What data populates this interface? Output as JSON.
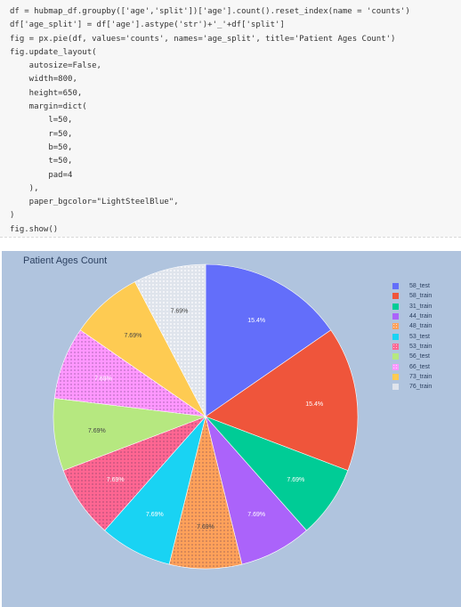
{
  "code": {
    "lines": [
      "df = hubmap_df.groupby(['age','split'])['age'].count().reset_index(name = 'counts')",
      "df['age_split'] = df['age'].astype('str')+'_'+df['split']",
      "fig = px.pie(df, values='counts', names='age_split', title='Patient Ages Count')",
      "fig.update_layout(",
      "    autosize=False,",
      "    width=800,",
      "    height=650,",
      "    margin=dict(",
      "        l=50,",
      "        r=50,",
      "        b=50,",
      "        t=50,",
      "        pad=4",
      "    ),",
      "    paper_bgcolor=\"LightSteelBlue\",",
      ")",
      "fig.show()"
    ]
  },
  "chart_data": {
    "type": "pie",
    "title": "Patient Ages Count",
    "labels": [
      "58_test",
      "58_train",
      "31_train",
      "44_train",
      "48_train",
      "53_test",
      "53_train",
      "56_test",
      "66_test",
      "73_train",
      "76_train"
    ],
    "values": [
      2,
      2,
      1,
      1,
      1,
      1,
      1,
      1,
      1,
      1,
      1
    ],
    "percent_labels": [
      "15.4%",
      "15.4%",
      "7.69%",
      "7.69%",
      "7.69%",
      "7.69%",
      "7.69%",
      "7.69%",
      "7.69%",
      "7.69%",
      "7.69%"
    ],
    "colors": [
      "#636efa",
      "#ef553b",
      "#00cc96",
      "#ab63fa",
      "#ffa15a",
      "#19d3f3",
      "#ff6692",
      "#b6e880",
      "#ff97ff",
      "#fecb52",
      "#ffffff"
    ],
    "patterned": [
      false,
      false,
      false,
      false,
      true,
      false,
      true,
      false,
      true,
      false,
      true
    ],
    "direction": "clockwise",
    "legend_position": "top-right"
  }
}
